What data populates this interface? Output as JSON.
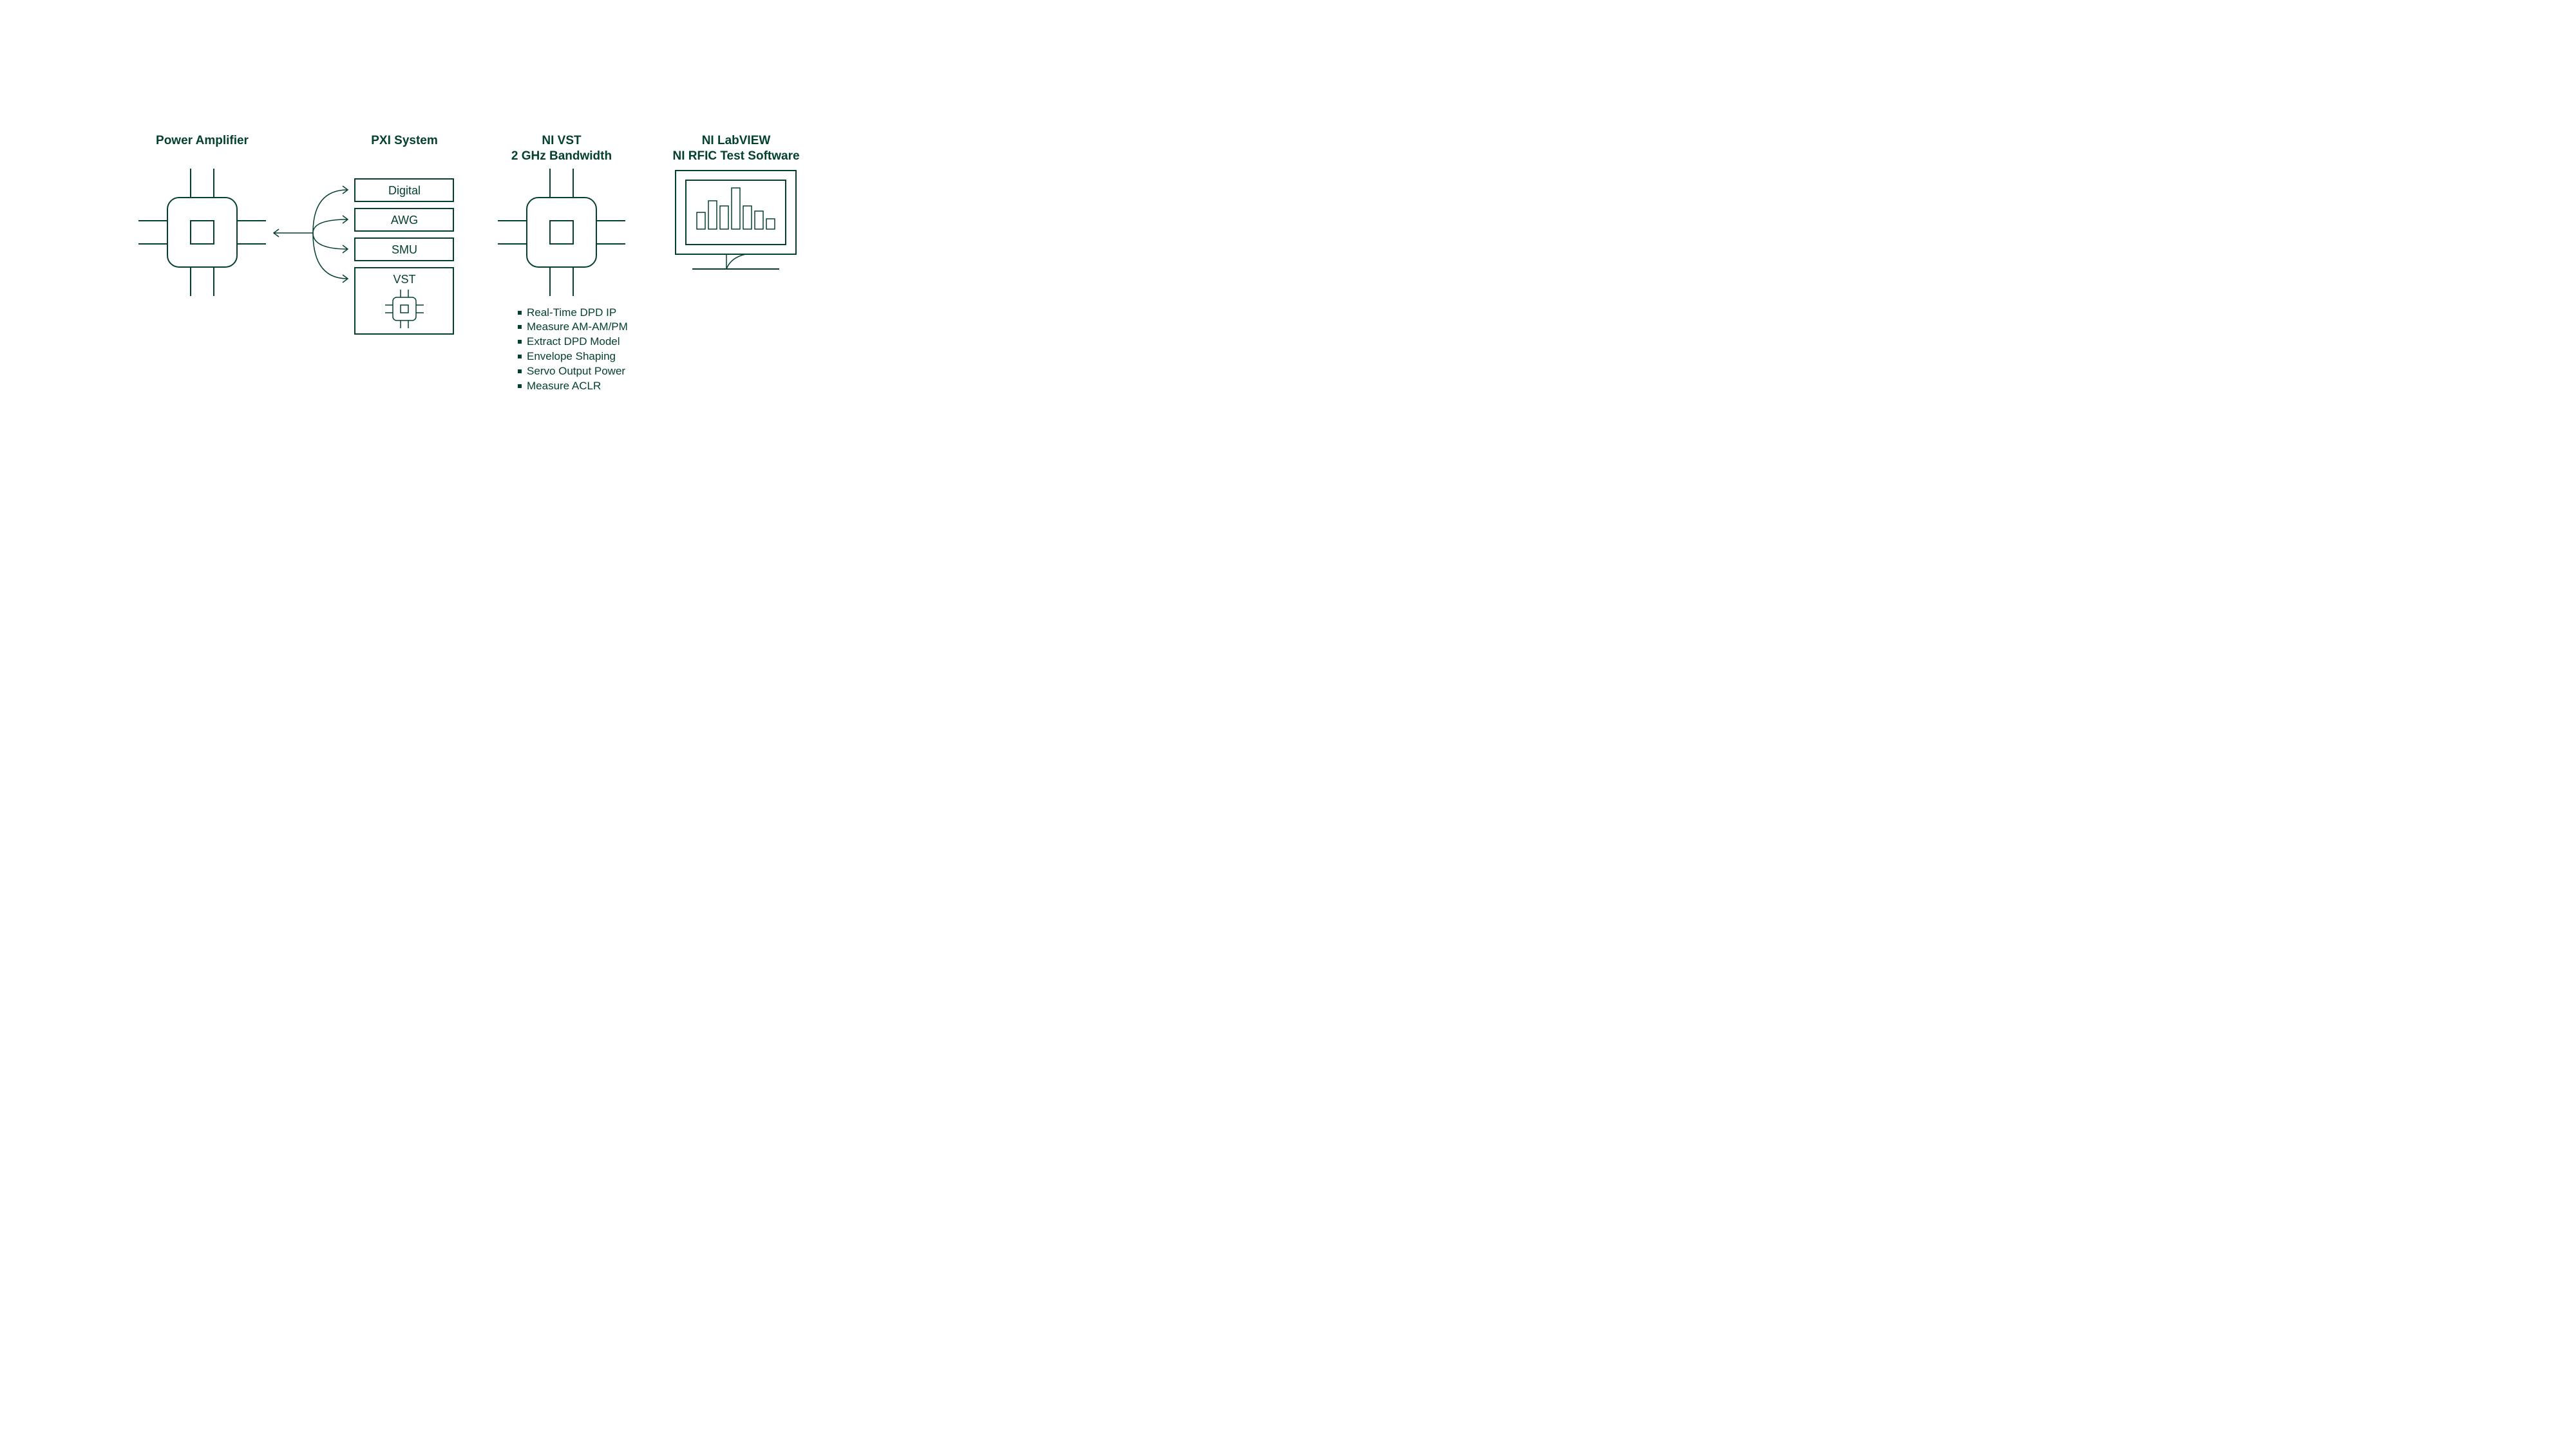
{
  "col1": {
    "title": "Power Amplifier"
  },
  "col2": {
    "title": "PXI System",
    "modules": [
      "Digital",
      "AWG",
      "SMU",
      "VST"
    ]
  },
  "col3": {
    "title_line1": "NI VST",
    "title_line2": "2 GHz Bandwidth",
    "bullets": [
      "Real-Time DPD IP",
      "Measure AM-AM/PM",
      "Extract DPD Model",
      "Envelope Shaping",
      "Servo Output Power",
      "Measure ACLR"
    ]
  },
  "col4": {
    "title_line1": "NI LabVIEW",
    "title_line2": "NI RFIC Test Software"
  }
}
